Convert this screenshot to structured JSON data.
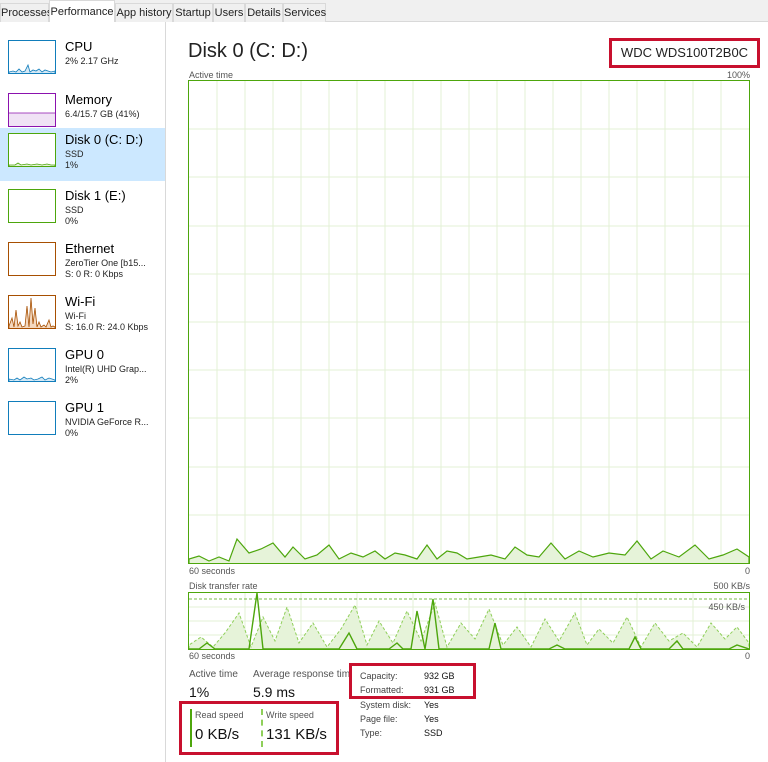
{
  "tabs": [
    {
      "label": "Processes",
      "active": false
    },
    {
      "label": "Performance",
      "active": true
    },
    {
      "label": "App history",
      "active": false
    },
    {
      "label": "Startup",
      "active": false
    },
    {
      "label": "Users",
      "active": false
    },
    {
      "label": "Details",
      "active": false
    },
    {
      "label": "Services",
      "active": false
    }
  ],
  "sidebar": {
    "items": [
      {
        "title": "CPU",
        "sub1": "2% 2.17 GHz",
        "sub2": "",
        "color": "#117dbb",
        "selected": false
      },
      {
        "title": "Memory",
        "sub1": "6.4/15.7 GB (41%)",
        "sub2": "",
        "color": "#8b12ae",
        "selected": false
      },
      {
        "title": "Disk 0 (C: D:)",
        "sub1": "SSD",
        "sub2": "1%",
        "color": "#4da60c",
        "selected": true
      },
      {
        "title": "Disk 1 (E:)",
        "sub1": "SSD",
        "sub2": "0%",
        "color": "#4da60c",
        "selected": false
      },
      {
        "title": "Ethernet",
        "sub1": "ZeroTier One [b15...",
        "sub2": "S: 0 R: 0 Kbps",
        "color": "#a74f01",
        "selected": false
      },
      {
        "title": "Wi-Fi",
        "sub1": "Wi-Fi",
        "sub2": "S: 16.0 R: 24.0 Kbps",
        "color": "#a74f01",
        "selected": false
      },
      {
        "title": "GPU 0",
        "sub1": "Intel(R) UHD Grap...",
        "sub2": "2%",
        "color": "#117dbb",
        "selected": false
      },
      {
        "title": "GPU 1",
        "sub1": "NVIDIA GeForce R...",
        "sub2": "0%",
        "color": "#117dbb",
        "selected": false
      }
    ]
  },
  "main": {
    "title": "Disk 0 (C: D:)",
    "model": "WDC WDS100T2B0C",
    "active_time_graph": {
      "label": "Active time",
      "max_label": "100%",
      "time_label": "60 seconds",
      "min_label": "0"
    },
    "transfer_graph": {
      "label": "Disk transfer rate",
      "max_label": "500 KB/s",
      "ref_label": "450 KB/s",
      "time_label": "60 seconds",
      "min_label": "0"
    }
  },
  "stats": {
    "active_time": {
      "label": "Active time",
      "value": "1%"
    },
    "avg_response": {
      "label": "Average response time",
      "value": "5.9 ms"
    },
    "read_speed": {
      "label": "Read speed",
      "value": "0 KB/s"
    },
    "write_speed": {
      "label": "Write speed",
      "value": "131 KB/s"
    }
  },
  "details": {
    "capacity": {
      "key": "Capacity:",
      "value": "932 GB"
    },
    "formatted": {
      "key": "Formatted:",
      "value": "931 GB"
    },
    "system_disk": {
      "key": "System disk:",
      "value": "Yes"
    },
    "page_file": {
      "key": "Page file:",
      "value": "Yes"
    },
    "type": {
      "key": "Type:",
      "value": "SSD"
    }
  },
  "colors": {
    "disk": "#4da60c",
    "highlight": "#c8102e",
    "selected_bg": "#cce8ff"
  }
}
